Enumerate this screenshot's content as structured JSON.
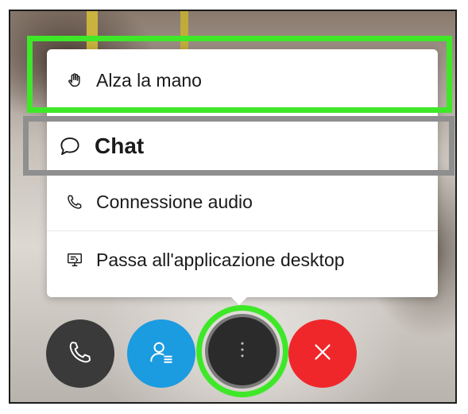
{
  "menu": {
    "items": [
      {
        "label": "Alza la mano",
        "icon": "raise-hand-icon"
      },
      {
        "label": "Chat",
        "icon": "chat-bubble-icon"
      },
      {
        "label": "Connessione audio",
        "icon": "phone-icon"
      },
      {
        "label": "Passa all'applicazione desktop",
        "icon": "desktop-icon"
      }
    ]
  },
  "controls": {
    "buttons": [
      {
        "name": "audio-call-button",
        "icon": "phone-icon",
        "color": "#3a3a3a"
      },
      {
        "name": "participants-button",
        "icon": "participants-icon",
        "color": "#1b9be0"
      },
      {
        "name": "more-options-button",
        "icon": "more-vertical-icon",
        "color": "#2b2b2b"
      },
      {
        "name": "end-meeting-button",
        "icon": "close-icon",
        "color": "#f0272a"
      }
    ]
  },
  "highlights": {
    "primary_color": "#3ee829",
    "secondary_color": "#8f8f8f"
  }
}
